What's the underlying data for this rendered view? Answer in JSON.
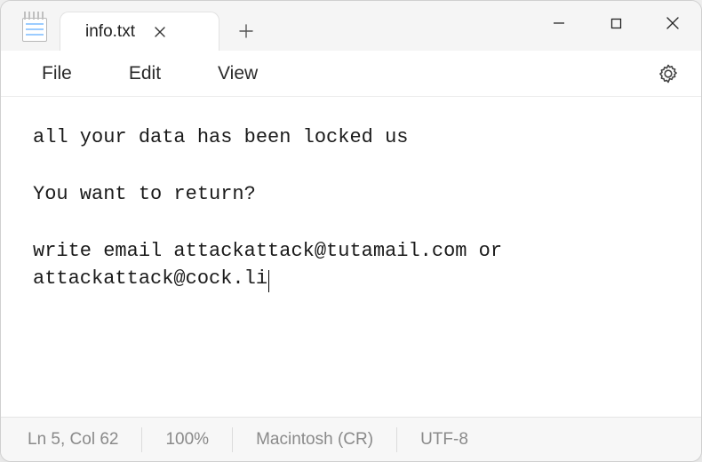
{
  "titlebar": {
    "tab_title": "info.txt"
  },
  "menu": {
    "file": "File",
    "edit": "Edit",
    "view": "View"
  },
  "content": {
    "line1": "all your data has been locked us",
    "line2": "",
    "line3": "You want to return?",
    "line4": "",
    "line5a": "write email attackattack@tutamail.com or ",
    "line5b": "attackattack@cock.li"
  },
  "status": {
    "position": "Ln 5, Col 62",
    "zoom": "100%",
    "eol": "Macintosh (CR)",
    "encoding": "UTF-8"
  },
  "icons": {
    "close_tab": "✕",
    "new_tab": "＋"
  }
}
